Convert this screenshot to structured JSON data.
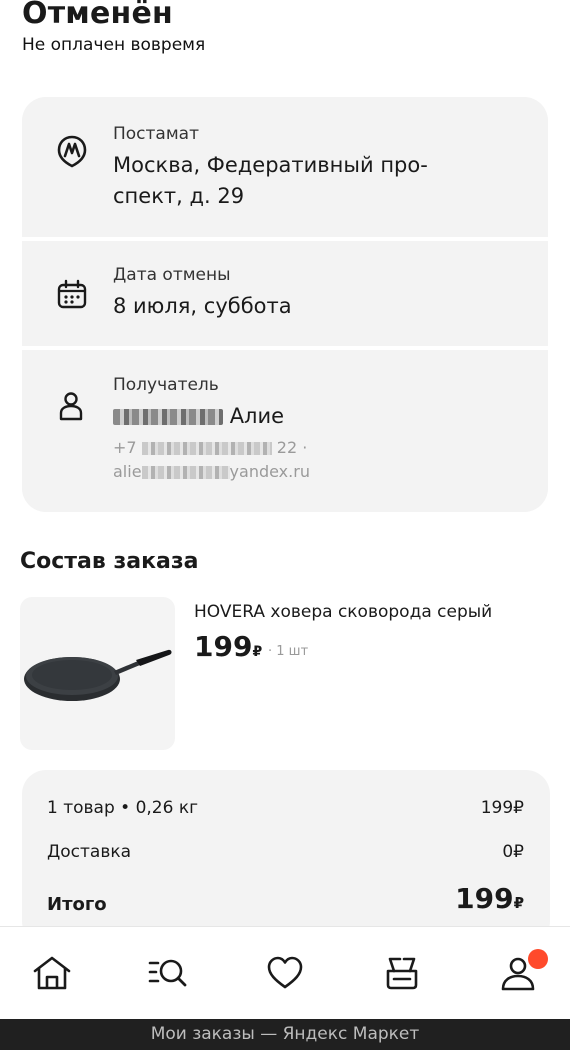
{
  "header": {
    "title": "Отменён",
    "subtitle": "Не оплачен вовремя"
  },
  "pickup": {
    "label": "Постамат",
    "address_line1": "Москва, Федеративный про-",
    "address_line2": "спект, д. 29",
    "icon": "market-logo-icon"
  },
  "cancel_date": {
    "label": "Дата отмены",
    "value": "8 июля, суббота",
    "icon": "calendar-icon"
  },
  "recipient": {
    "label": "Получатель",
    "name_visible": "Алие",
    "phone_prefix": "+7",
    "phone_suffix": "22 ·",
    "email_prefix": "alie",
    "email_suffix": "yandex.ru",
    "icon": "person-icon"
  },
  "order": {
    "section_title": "Состав заказа",
    "items": [
      {
        "name": "HOVERA ховера сковорода серый",
        "price": "199",
        "currency": "₽",
        "qty": "· 1 шт"
      }
    ]
  },
  "summary": {
    "items_label": "1 товар • 0,26 кг",
    "items_value": "199₽",
    "delivery_label": "Доставка",
    "delivery_value": "0₽",
    "total_label": "Итого",
    "total_value": "199",
    "total_currency": "₽"
  },
  "tabbar": {
    "tabs": [
      "home-icon",
      "catalog-search-icon",
      "favorites-heart-icon",
      "cart-icon",
      "profile-icon"
    ],
    "badge_color": "#ff4a2b"
  },
  "browser": {
    "page_title": "Мои заказы — Яндекс Маркет"
  }
}
